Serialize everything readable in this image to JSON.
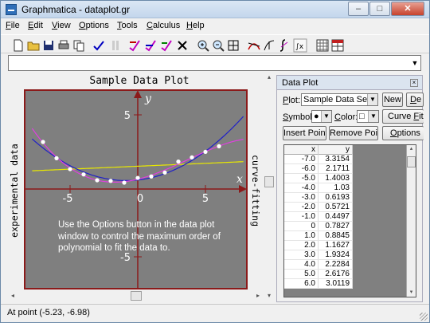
{
  "window": {
    "title": "Graphmatica - dataplot.gr"
  },
  "menu": [
    {
      "hot": "F",
      "rest": "ile"
    },
    {
      "hot": "E",
      "rest": "dit"
    },
    {
      "hot": "V",
      "rest": "iew"
    },
    {
      "hot": "O",
      "rest": "ptions"
    },
    {
      "hot": "T",
      "rest": "ools"
    },
    {
      "hot": "C",
      "rest": "alculus"
    },
    {
      "hot": "H",
      "rest": "elp"
    }
  ],
  "equation": {
    "value": ""
  },
  "graph": {
    "title": "Sample Data Plot",
    "left_label": "experimental data",
    "right_label": "curve-fitting",
    "x_axis_label": "x",
    "y_axis_label": "y",
    "tick_5": "5",
    "tick_neg5": "-5",
    "tick_0": "0",
    "annotation": [
      "Use the Options button in the data plot",
      "window to control the maximum order of",
      "polynomial to fit the data to."
    ],
    "colors": {
      "background": "#7f7f7f",
      "border": "#8b1a1a",
      "axes": "#8b1a1a",
      "points": "#ffffff",
      "magenta": "#e040e0",
      "blue": "#2020c8",
      "yellow": "#e8e800"
    }
  },
  "data_plot_panel": {
    "title": "Data Plot",
    "plot_label_hot": "P",
    "plot_label_rest": "lot:",
    "plot_value": "Sample Data Set",
    "new_button": "New",
    "del_button_hot": "D",
    "del_button_rest": "e",
    "symbol_label_hot": "S",
    "symbol_label_rest": "ymbol:",
    "symbol_value": "●",
    "color_label_hot": "C",
    "color_label_rest": "olor:",
    "color_value": "□",
    "curve_fit_button": {
      "pre": "Curve ",
      "hot": "F",
      "post": "it"
    },
    "insert_point_button": "Insert Point",
    "remove_point_button": "Remove Point",
    "options_button_hot": "O",
    "options_button_rest": "ptions",
    "columns": [
      "x",
      "y"
    ],
    "rows": [
      [
        "-7.0",
        "3.3154"
      ],
      [
        "-6.0",
        "2.1711"
      ],
      [
        "-5.0",
        "1.4003"
      ],
      [
        "-4.0",
        "1.03"
      ],
      [
        "-3.0",
        "0.6193"
      ],
      [
        "-2.0",
        "0.5721"
      ],
      [
        "-1.0",
        "0.4497"
      ],
      [
        "0",
        "0.7827"
      ],
      [
        "1.0",
        "0.8845"
      ],
      [
        "2.0",
        "1.1627"
      ],
      [
        "3.0",
        "1.9324"
      ],
      [
        "4.0",
        "2.2284"
      ],
      [
        "5.0",
        "2.6176"
      ],
      [
        "6.0",
        "3.0119"
      ]
    ]
  },
  "status": {
    "text": "At point (-5.23, -6.98)"
  }
}
